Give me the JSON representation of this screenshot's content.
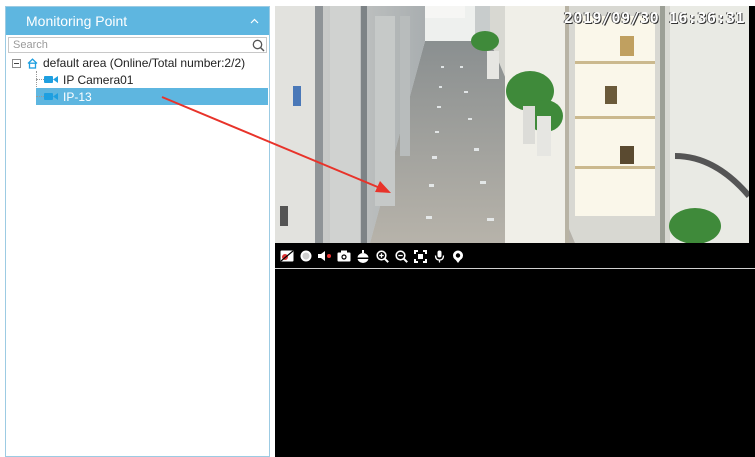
{
  "panel": {
    "title": "Monitoring Point",
    "search_placeholder": "Search",
    "root_label": "default area (Online/Total number:2/2)",
    "items": [
      {
        "label": "IP Camera01",
        "selected": false
      },
      {
        "label": "IP-13",
        "selected": true
      }
    ]
  },
  "video": {
    "timestamp": "2019/09/30  16:36:31"
  },
  "toolbar_icons": [
    "record-icon",
    "snapshot-dot-icon",
    "audio-icon",
    "camera-icon",
    "ptz-icon",
    "zoom-in-icon",
    "zoom-out-icon",
    "fit-screen-icon",
    "microphone-icon",
    "location-icon"
  ],
  "colors": {
    "header": "#5eb6e0",
    "selected": "#5eb6e0",
    "camera_icon": "#1e9fe0",
    "arrow": "#e8332a"
  }
}
